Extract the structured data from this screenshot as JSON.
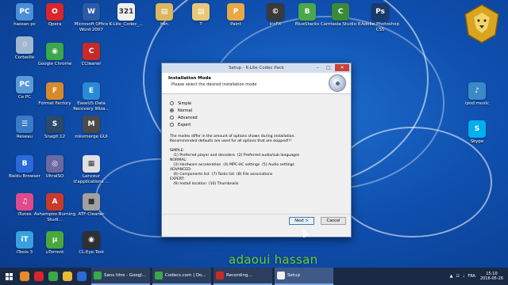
{
  "desktop_icons": [
    {
      "label": "hassan pc",
      "color": "#4a8fd8",
      "glyph": "PC"
    },
    {
      "label": "Corbeille",
      "color": "#9fb7d0",
      "glyph": "♲"
    },
    {
      "label": "Ce PC",
      "color": "#5a9ad8",
      "glyph": "PC"
    },
    {
      "label": "Reseau",
      "color": "#3a7ac8",
      "glyph": "☰"
    },
    {
      "label": "Baidu Browser",
      "color": "#2a6ad8",
      "glyph": "B"
    },
    {
      "label": "iTunes",
      "color": "#e04a8a",
      "glyph": "♫"
    },
    {
      "label": "iTools 3",
      "color": "#3aa0e0",
      "glyph": "iT"
    },
    {
      "label": "Opera",
      "color": "#d8262c",
      "glyph": "O"
    },
    {
      "label": "Google Chrome",
      "color": "#3aa84a",
      "glyph": "◉"
    },
    {
      "label": "Format Factory",
      "color": "#d88a2a",
      "glyph": "F"
    },
    {
      "label": "Snagit 12",
      "color": "#2a4a6a",
      "glyph": "S"
    },
    {
      "label": "UltraISO",
      "color": "#6a6aa0",
      "glyph": "◎"
    },
    {
      "label": "Ashampoo Burning Studi...",
      "color": "#c83a2a",
      "glyph": "A"
    },
    {
      "label": "uTorrent",
      "color": "#4aa83a",
      "glyph": "µ"
    },
    {
      "label": "Microsoft Office Word 2007",
      "color": "#2a5aa8",
      "glyph": "W"
    },
    {
      "label": "CCleaner",
      "color": "#c82a2a",
      "glyph": "C"
    },
    {
      "label": "EaseUS Data Recovery Wiza...",
      "color": "#2a8ad8",
      "glyph": "E"
    },
    {
      "label": "mkvmerge GUI",
      "color": "#4a4a4a",
      "glyph": "M"
    },
    {
      "label": "Lanceur d'applications ...",
      "color": "#e0e0e0",
      "glyph": "▦"
    },
    {
      "label": "ATF-Cleaner",
      "color": "#a0a0a0",
      "glyph": "■"
    },
    {
      "label": "CL-Eye Test",
      "color": "#303030",
      "glyph": "◉"
    },
    {
      "label": "K-Lite_Codec_...",
      "color": "#f0f0f0",
      "glyph": "321"
    },
    {
      "label": "hsn",
      "color": "#d8b860",
      "glyph": "▤"
    },
    {
      "label": "T",
      "color": "#e8c878",
      "glyph": "▤"
    },
    {
      "label": "Paint",
      "color": "#e8a848",
      "glyph": "P"
    },
    {
      "label": "icoFX",
      "color": "#3a3a3a",
      "glyph": "©"
    },
    {
      "label": "BlueStacks",
      "color": "#4aa84a",
      "glyph": "B"
    },
    {
      "label": "Camtasia Studio 8",
      "color": "#3a8a3a",
      "glyph": "C"
    },
    {
      "label": "Adobe Photoshop CS5",
      "color": "#1a3a6a",
      "glyph": "Ps"
    },
    {
      "label": "ipod music",
      "color": "#3a8ac8",
      "glyph": "♪"
    },
    {
      "label": "Skype",
      "color": "#00aff0",
      "glyph": "S"
    }
  ],
  "dialog": {
    "title": "Setup - K-Lite Codec Pack",
    "header_title": "Installation Mode",
    "header_sub": "Please select the desired installation mode",
    "options": [
      {
        "label": "Simple",
        "checked": false
      },
      {
        "label": "Normal",
        "checked": true
      },
      {
        "label": "Advanced",
        "checked": false
      },
      {
        "label": "Expert",
        "checked": false
      }
    ],
    "description": "The modes differ in the amount of options shown during installation.\nRecommended defaults are used for all options that are skipped!!!",
    "mode_details": "SIMPLE:\n   (1) Preferred player and decoders  (2) Preferred audio/sub languages\nNORMAL:\n   (3) Hardware acceleration  (4) MPC-HC settings  (5) Audio settings\nADVANCED:\n   (6) Components list  (7) Tasks list  (8) File associations\nEXPERT:\n   (9) Install location  (10) Thumbnails",
    "next_label": "Next >",
    "cancel_label": "Cancel",
    "close_label": "✕",
    "min_label": "–",
    "max_label": "□"
  },
  "watermark": "adaoui hassan",
  "taskbar": {
    "pins": [
      {
        "color": "#e88a2a"
      },
      {
        "color": "#d8262c"
      },
      {
        "color": "#3aa84a"
      },
      {
        "color": "#e8b838"
      },
      {
        "color": "#2a6ad8"
      }
    ],
    "tasks": [
      {
        "label": "Sans titre - Googl...",
        "color": "#3aa84a"
      },
      {
        "label": "Codecs.com | Do...",
        "color": "#3aa84a"
      },
      {
        "label": "Recording...",
        "color": "#c82a2a"
      },
      {
        "label": "Setup",
        "color": "#f0f0f0"
      }
    ],
    "tray": {
      "lang": "FRA",
      "time": "15:10",
      "date": "2016-05-26"
    }
  }
}
